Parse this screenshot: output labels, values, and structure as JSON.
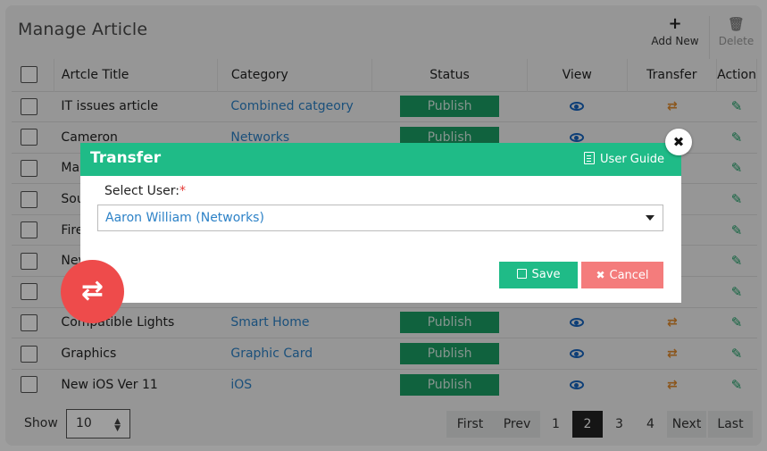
{
  "header": {
    "title": "Manage Article"
  },
  "toolbar": {
    "add_label": "Add New",
    "delete_label": "Delete"
  },
  "table": {
    "columns": {
      "title": "Artcle Title",
      "category": "Category",
      "status": "Status",
      "view": "View",
      "transfer": "Transfer",
      "action": "Action"
    },
    "rows": [
      {
        "title": "IT issues article",
        "category": "Combined catgeory",
        "status": "Publish"
      },
      {
        "title": "Cameron",
        "category": "Networks",
        "status": "Publish"
      },
      {
        "title": "Ma",
        "category": "",
        "status": ""
      },
      {
        "title": "Sou",
        "category": "",
        "status": ""
      },
      {
        "title": "Fire",
        "category": "",
        "status": ""
      },
      {
        "title": "Nev",
        "category": "",
        "status": ""
      },
      {
        "title": "",
        "category": "",
        "status": ""
      },
      {
        "title": "Compatible Lights",
        "category": "Smart Home",
        "status": "Publish"
      },
      {
        "title": "Graphics",
        "category": "Graphic Card",
        "status": "Publish"
      },
      {
        "title": "New iOS Ver 11",
        "category": "iOS",
        "status": "Publish"
      }
    ]
  },
  "footer": {
    "show_label": "Show",
    "page_size": "10",
    "pagination": {
      "first": "First",
      "prev": "Prev",
      "pages": [
        "1",
        "2",
        "3",
        "4"
      ],
      "current": "2",
      "next": "Next",
      "last": "Last"
    }
  },
  "modal": {
    "title": "Transfer",
    "user_guide": "User Guide",
    "select_label": "Select User:",
    "required_mark": "*",
    "selected_user": "Aaron William (Networks)",
    "save_label": "Save",
    "cancel_label": "Cancel"
  },
  "icons": {
    "add": "plus-icon",
    "delete": "trash-icon",
    "view": "eye-icon",
    "transfer": "swap-arrows-icon",
    "edit": "pencil-icon",
    "close": "close-icon",
    "guide": "document-icon",
    "save": "floppy-icon",
    "cancel": "x-icon"
  },
  "colors": {
    "publish": "#1a9f65",
    "link": "#2d82c7",
    "modal_header": "#1fbb87",
    "cancel": "#f47c7c",
    "fab": "#ee4b4b",
    "transfer_icon": "#e08a2c"
  }
}
